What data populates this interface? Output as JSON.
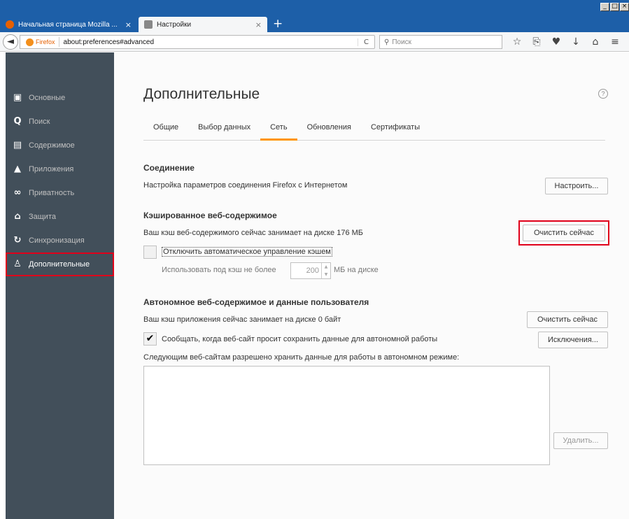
{
  "window": {
    "buttons": [
      "_",
      "□",
      "×"
    ]
  },
  "tabs": [
    {
      "label": "Начальная страница Mozilla ...",
      "close": "×",
      "favicon_color": "#e66000"
    },
    {
      "label": "Настройки",
      "close": "×"
    }
  ],
  "newtab_label": "+",
  "navbar": {
    "back": "◄",
    "identity": "Firefox",
    "url": "about:preferences#advanced",
    "reload": "C",
    "search_placeholder": "Поиск",
    "search_icon": "magnifier-icon",
    "icons": [
      "star-icon",
      "bookmarks-list-icon",
      "pocket-icon",
      "download-icon",
      "home-icon",
      "menu-icon"
    ],
    "icon_glyphs": [
      "☆",
      "⎘",
      "♥",
      "↓",
      "⌂",
      "≡"
    ]
  },
  "sidebar": {
    "items": [
      {
        "label": "Основные",
        "glyph": "▣",
        "icon": "general-icon"
      },
      {
        "label": "Поиск",
        "glyph": "Q",
        "icon": "search-icon"
      },
      {
        "label": "Содержимое",
        "glyph": "▤",
        "icon": "content-icon"
      },
      {
        "label": "Приложения",
        "glyph": "▲",
        "icon": "applications-icon"
      },
      {
        "label": "Приватность",
        "glyph": "∞",
        "icon": "privacy-mask-icon"
      },
      {
        "label": "Защита",
        "glyph": "⌂",
        "icon": "security-lock-icon"
      },
      {
        "label": "Синхронизация",
        "glyph": "↻",
        "icon": "sync-icon"
      },
      {
        "label": "Дополнительные",
        "glyph": "♙",
        "icon": "advanced-wizard-icon"
      }
    ],
    "selected_index": 7
  },
  "page": {
    "title": "Дополнительные",
    "help": "?",
    "subtabs": [
      "Общие",
      "Выбор данных",
      "Сеть",
      "Обновления",
      "Сертификаты"
    ],
    "active_subtab": "Сеть",
    "connection": {
      "heading": "Соединение",
      "text": "Настройка параметров соединения Firefox с Интернетом",
      "button": "Настроить..."
    },
    "cache": {
      "heading": "Кэшированное веб-содержимое",
      "text": "Ваш кэш веб-содержимого сейчас занимает на диске 176 МБ",
      "button": "Очистить сейчас",
      "override_label": "Отключить автоматическое управление кэшем",
      "override_checked": false,
      "limit_label": "Использовать под кэш не более",
      "limit_value": "200",
      "limit_unit": "МБ на диске"
    },
    "offline": {
      "heading": "Автономное веб-содержимое и данные пользователя",
      "text": "Ваш кэш приложения сейчас занимает на диске 0 байт",
      "clear_button": "Очистить сейчас",
      "notify_label": "Сообщать, когда веб-сайт просит сохранить данные для автономной работы",
      "notify_checked": true,
      "check_glyph": "✔",
      "exceptions_button": "Исключения...",
      "list_label": "Следующим веб-сайтам разрешено хранить данные для работы в автономном режиме:",
      "remove_button": "Удалить..."
    }
  },
  "colors": {
    "titlebar": "#1d5fa8",
    "sidebar": "#424f5a",
    "accent_tab": "#ff9500",
    "highlight": "#e0001a"
  }
}
